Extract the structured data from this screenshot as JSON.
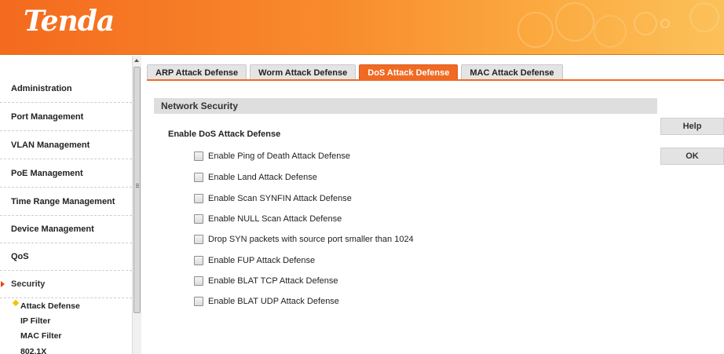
{
  "header": {
    "logo_text": "Tenda"
  },
  "sidebar": {
    "items": [
      {
        "label": "Administration"
      },
      {
        "label": "Port Management"
      },
      {
        "label": "VLAN Management"
      },
      {
        "label": "PoE Management"
      },
      {
        "label": "Time Range Management"
      },
      {
        "label": "Device Management"
      },
      {
        "label": "QoS"
      },
      {
        "label": "Security"
      }
    ],
    "active_item": "Security",
    "sub_items": [
      {
        "label": "Attack Defense"
      },
      {
        "label": "IP Filter"
      },
      {
        "label": "MAC Filter"
      },
      {
        "label": "802.1X"
      }
    ],
    "active_sub_item": "Attack Defense"
  },
  "tabs": [
    {
      "label": "ARP Attack Defense"
    },
    {
      "label": "Worm Attack Defense"
    },
    {
      "label": "DoS Attack Defense"
    },
    {
      "label": "MAC Attack Defense"
    }
  ],
  "active_tab": "DoS Attack Defense",
  "main": {
    "section_title": "Network Security",
    "subheading": "Enable DoS Attack Defense",
    "options": [
      {
        "label": "Enable Ping of Death Attack Defense",
        "checked": false
      },
      {
        "label": "Enable Land Attack Defense",
        "checked": false
      },
      {
        "label": "Enable Scan SYNFIN Attack Defense",
        "checked": false
      },
      {
        "label": "Enable NULL Scan Attack Defense",
        "checked": false
      },
      {
        "label": "Drop SYN packets with source port smaller than 1024",
        "checked": false
      },
      {
        "label": "Enable FUP Attack Defense",
        "checked": false
      },
      {
        "label": "Enable BLAT TCP Attack Defense",
        "checked": false
      },
      {
        "label": "Enable BLAT UDP Attack Defense",
        "checked": false
      }
    ]
  },
  "buttons": {
    "help": "Help",
    "ok": "OK"
  },
  "colors": {
    "accent": "#f06a24",
    "header_start": "#f46a1e",
    "header_end": "#fcc15a",
    "section_bg": "#dedede"
  }
}
